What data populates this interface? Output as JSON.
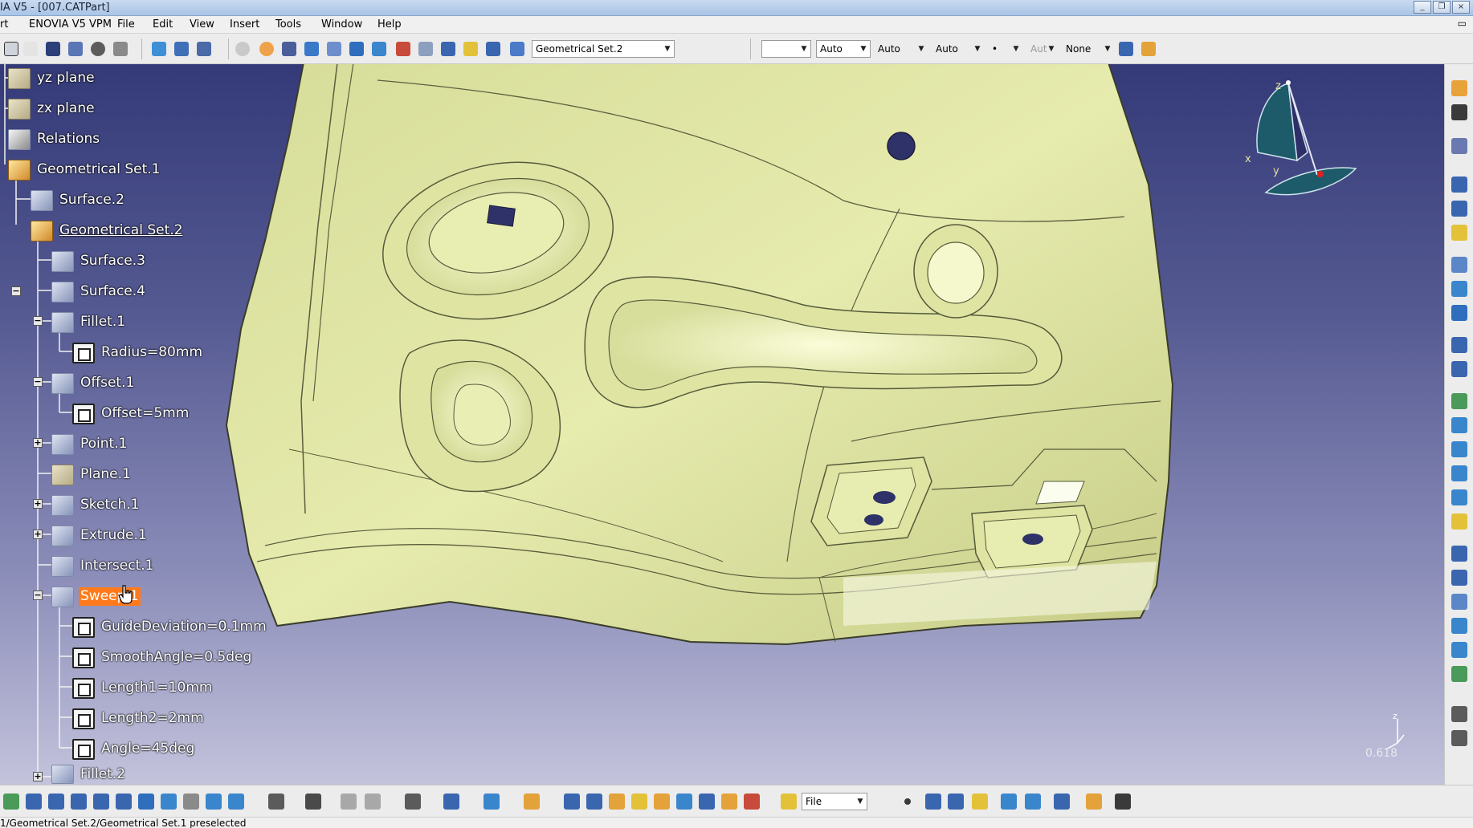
{
  "window": {
    "title": "IA V5 - [007.CATPart]"
  },
  "menu": {
    "items": [
      "rt",
      "ENOVIA V5 VPM",
      "File",
      "Edit",
      "View",
      "Insert",
      "Tools",
      "Window",
      "Help"
    ]
  },
  "toolbar": {
    "current_set": "Geometrical Set.2",
    "color_combo": "",
    "line_type_1": "Auto",
    "line_type_2": "Auto",
    "line_type_3": "Auto",
    "point_combo": "•",
    "layer_combo": "Aut",
    "filter_combo": "None"
  },
  "tree": {
    "items": [
      {
        "label": "yz plane"
      },
      {
        "label": "zx plane"
      },
      {
        "label": "Relations"
      },
      {
        "label": "Geometrical Set.1"
      },
      {
        "label": "Surface.2"
      },
      {
        "label": "Geometrical Set.2"
      },
      {
        "label": "Surface.3"
      },
      {
        "label": "Surface.4"
      },
      {
        "label": "Fillet.1"
      },
      {
        "label": "Radius=80mm"
      },
      {
        "label": "Offset.1"
      },
      {
        "label": "Offset=5mm"
      },
      {
        "label": "Point.1"
      },
      {
        "label": "Plane.1"
      },
      {
        "label": "Sketch.1"
      },
      {
        "label": "Extrude.1"
      },
      {
        "label": "Intersect.1"
      },
      {
        "label": "Sweep.1"
      },
      {
        "label": "GuideDeviation=0.1mm"
      },
      {
        "label": "SmoothAngle=0.5deg"
      },
      {
        "label": "Length1=10mm"
      },
      {
        "label": "Length2=2mm"
      },
      {
        "label": "Angle=45deg"
      },
      {
        "label": "Fillet.2"
      }
    ]
  },
  "compass": {
    "x_label": "x",
    "y_label": "y",
    "z_label": "z"
  },
  "mini_compass": {
    "z_label": "z"
  },
  "viewport": {
    "zoom_value": "0.618"
  },
  "bottom_toolbar": {
    "file_combo": "File"
  },
  "status": {
    "text": "1/Geometrical Set.2/Geometrical Set.1 preselected"
  },
  "colors": {
    "part_surface": "#e2e7a4",
    "edge_lines": "#555a3a",
    "background_top": "#343a78",
    "background_bottom": "#c3c3dc",
    "selection": "#ff7a1a"
  }
}
